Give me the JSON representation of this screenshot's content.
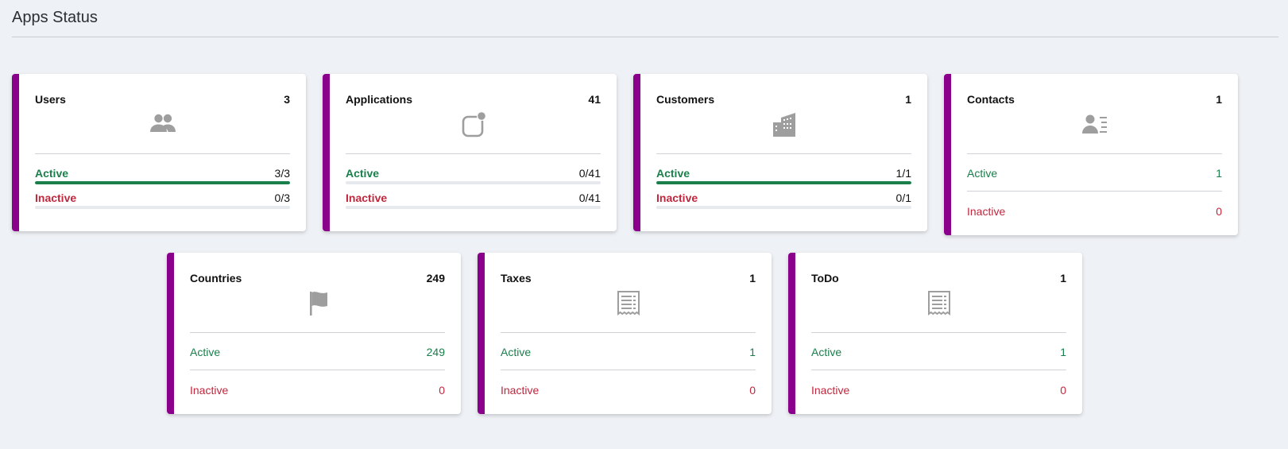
{
  "header": {
    "title": "Apps Status"
  },
  "colors": {
    "accent": "#8b008b",
    "active": "#1a7f4b",
    "inactive": "#c0273d",
    "icon": "#9e9e9e"
  },
  "cards": {
    "users": {
      "name": "Users",
      "count": "3",
      "icon": "users-icon",
      "active_label": "Active",
      "active_value": "3/3",
      "active_progress": 1.0,
      "inactive_label": "Inactive",
      "inactive_value": "0/3",
      "inactive_progress": 0.0
    },
    "applications": {
      "name": "Applications",
      "count": "41",
      "icon": "application-icon",
      "active_label": "Active",
      "active_value": "0/41",
      "active_progress": 0.0,
      "inactive_label": "Inactive",
      "inactive_value": "0/41",
      "inactive_progress": 0.0
    },
    "customers": {
      "name": "Customers",
      "count": "1",
      "icon": "building-icon",
      "active_label": "Active",
      "active_value": "1/1",
      "active_progress": 1.0,
      "inactive_label": "Inactive",
      "inactive_value": "0/1",
      "inactive_progress": 0.0
    },
    "contacts": {
      "name": "Contacts",
      "count": "1",
      "icon": "contact-card-icon",
      "active_label": "Active",
      "active_value": "1",
      "inactive_label": "Inactive",
      "inactive_value": "0"
    },
    "countries": {
      "name": "Countries",
      "count": "249",
      "icon": "flag-icon",
      "active_label": "Active",
      "active_value": "249",
      "inactive_label": "Inactive",
      "inactive_value": "0"
    },
    "taxes": {
      "name": "Taxes",
      "count": "1",
      "icon": "receipt-icon",
      "active_label": "Active",
      "active_value": "1",
      "inactive_label": "Inactive",
      "inactive_value": "0"
    },
    "todo": {
      "name": "ToDo",
      "count": "1",
      "icon": "receipt-icon",
      "active_label": "Active",
      "active_value": "1",
      "inactive_label": "Inactive",
      "inactive_value": "0"
    }
  }
}
